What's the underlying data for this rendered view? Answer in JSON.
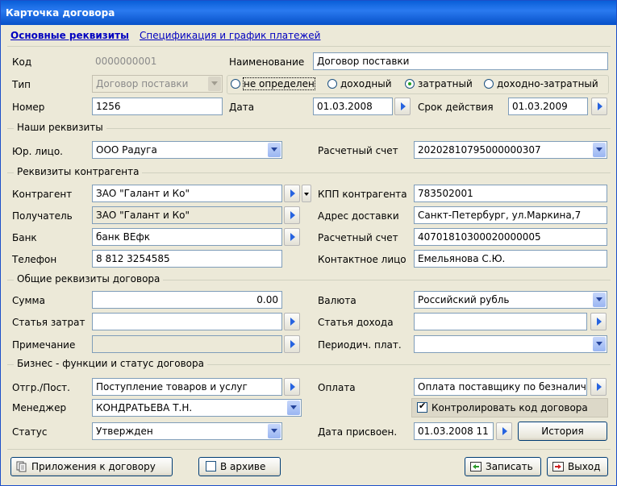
{
  "window": {
    "title": "Карточка договора"
  },
  "tabs": [
    {
      "label": "Основные реквизиты"
    },
    {
      "label": "Спецификация и график платежей"
    }
  ],
  "contract": {
    "code_label": "Код",
    "code_value": "0000000001",
    "name_label": "Наименование",
    "name_value": "Договор поставки",
    "type_label": "Тип",
    "type_value": "Договор поставки",
    "type_radios": [
      {
        "label": "не определен",
        "selected": false
      },
      {
        "label": "доходный",
        "selected": false
      },
      {
        "label": "затратный",
        "selected": true
      },
      {
        "label": "доходно-затратный",
        "selected": false
      }
    ],
    "number_label": "Номер",
    "number_value": "1256",
    "date_label": "Дата",
    "date_value": "01.03.2008",
    "validity_label": "Срок действия",
    "validity_value": "01.03.2009"
  },
  "our_details": {
    "section_title": "Наши реквизиты",
    "legal_entity_label": "Юр. лицо.",
    "legal_entity_value": "ООО Радуга",
    "account_label": "Расчетный счет",
    "account_value": "20202810795000000307"
  },
  "counterparty": {
    "section_title": "Реквизиты контрагента",
    "counterparty_label": "Контрагент",
    "counterparty_value": "ЗАО \"Галант и Ко\"",
    "kpp_label": "КПП контрагента",
    "kpp_value": "783502001",
    "recipient_label": "Получатель",
    "recipient_value": "ЗАО \"Галант и Ко\"",
    "delivery_address_label": "Адрес доставки",
    "delivery_address_value": "Санкт-Петербург, ул.Маркина,7",
    "bank_label": "Банк",
    "bank_value": "банк ВЕфк",
    "account_label": "Расчетный счет",
    "account_value": "40701810300020000005",
    "phone_label": "Телефон",
    "phone_value": "8 812 3254585",
    "contact_label": "Контактное лицо",
    "contact_value": "Емельянова С.Ю."
  },
  "general": {
    "section_title": "Общие реквизиты договора",
    "sum_label": "Сумма",
    "sum_value": "0.00",
    "currency_label": "Валюта",
    "currency_value": "Российский рубль",
    "expense_item_label": "Статья затрат",
    "expense_item_value": "",
    "income_item_label": "Статья дохода",
    "income_item_value": "",
    "note_label": "Примечание",
    "note_value": "",
    "periodic_label": "Периодич. плат.",
    "periodic_value": ""
  },
  "business": {
    "section_title": "Бизнес - функции и статус договора",
    "shipment_label": "Отгр./Пост.",
    "shipment_value": "Поступление товаров и услуг",
    "payment_label": "Оплата",
    "payment_value": "Оплата поставщику по безналич",
    "manager_label": "Менеджер",
    "manager_value": "КОНДРАТЬЕВА Т.Н.",
    "control_code_label": "Контролировать код договора",
    "control_code_checked": true,
    "status_label": "Статус",
    "status_value": "Утвержден",
    "assigned_date_label": "Дата присвоен.",
    "assigned_date_value": "01.03.2008 11",
    "history_button": "История"
  },
  "footer": {
    "attachments_button": "Приложения к договору",
    "archive_label": "В архиве",
    "archive_checked": false,
    "save_button": "Записать",
    "exit_button": "Выход"
  },
  "colors": {
    "title_bar": "#0a5fd8",
    "window_bg": "#ece9d8",
    "link": "#0000c0",
    "arrow": "#2663e0"
  }
}
